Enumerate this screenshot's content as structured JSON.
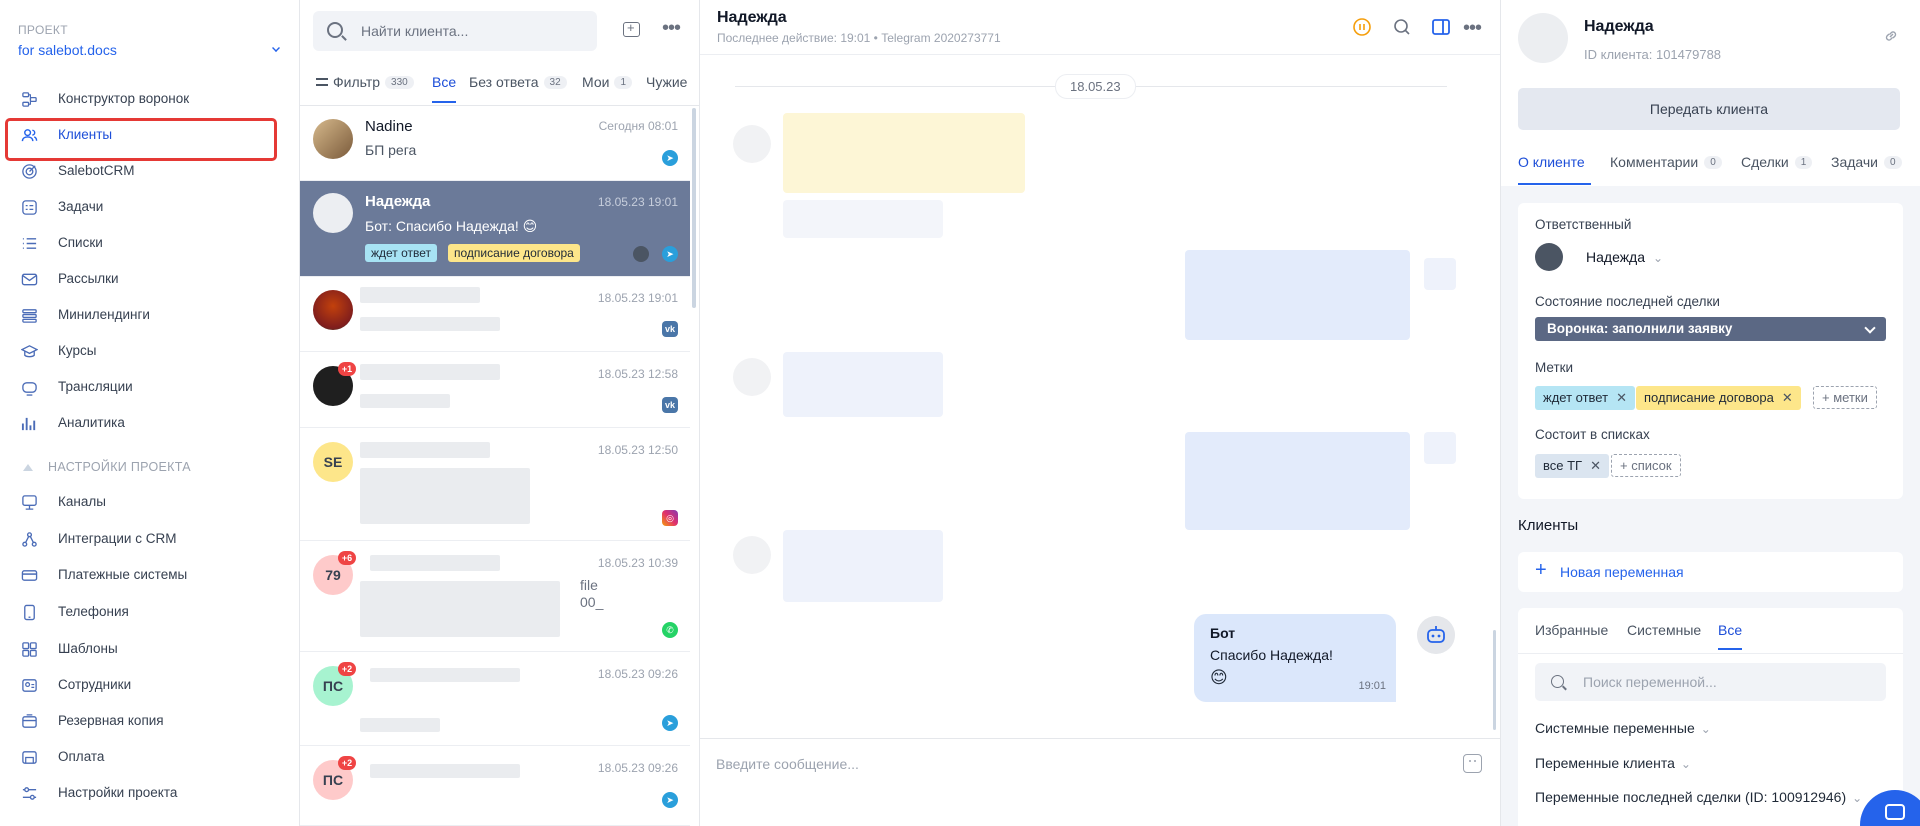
{
  "sidebar": {
    "project_caption": "ПРОЕКТ",
    "project_name": "for salebot.docs",
    "items": [
      {
        "label": "Конструктор воронок",
        "icon": "funnel-builder-icon"
      },
      {
        "label": "Клиенты",
        "icon": "users-icon",
        "active": true
      },
      {
        "label": "SalebotCRM",
        "icon": "crm-icon"
      },
      {
        "label": "Задачи",
        "icon": "tasks-icon"
      },
      {
        "label": "Списки",
        "icon": "lists-icon"
      },
      {
        "label": "Рассылки",
        "icon": "mailing-icon"
      },
      {
        "label": "Минилендинги",
        "icon": "landing-icon"
      },
      {
        "label": "Курсы",
        "icon": "courses-icon"
      },
      {
        "label": "Трансляции",
        "icon": "broadcast-icon"
      },
      {
        "label": "Аналитика",
        "icon": "analytics-icon"
      }
    ],
    "settings_header": "НАСТРОЙКИ ПРОЕКТА",
    "settings_items": [
      {
        "label": "Каналы",
        "icon": "channels-icon"
      },
      {
        "label": "Интеграции с CRM",
        "icon": "integrations-icon"
      },
      {
        "label": "Платежные системы",
        "icon": "payment-icon"
      },
      {
        "label": "Телефония",
        "icon": "phone-icon"
      },
      {
        "label": "Шаблоны",
        "icon": "templates-icon"
      },
      {
        "label": "Сотрудники",
        "icon": "staff-icon"
      },
      {
        "label": "Резервная копия",
        "icon": "backup-icon"
      },
      {
        "label": "Оплата",
        "icon": "billing-icon"
      },
      {
        "label": "Настройки проекта",
        "icon": "settings-icon"
      }
    ]
  },
  "client_list": {
    "search_placeholder": "Найти клиента...",
    "tabs": [
      {
        "label": "Фильтр",
        "count": "330"
      },
      {
        "label": "Все"
      },
      {
        "label": "Без ответа",
        "count": "32"
      },
      {
        "label": "Мои",
        "count": "1"
      },
      {
        "label": "Чужие"
      }
    ],
    "rows": [
      {
        "name": "Nadine",
        "message": "БП рега",
        "time": "Сегодня 08:01",
        "messenger": "telegram"
      },
      {
        "name": "Надежда",
        "message": "Бот: Спасибо Надежда! 😊",
        "time": "18.05.23 19:01",
        "messenger": "telegram",
        "tags": [
          "ждет ответ",
          "подписание договора"
        ]
      },
      {
        "time": "18.05.23 19:01",
        "messenger": "vk"
      },
      {
        "time": "18.05.23 12:58",
        "messenger": "vk",
        "badge": "+1"
      },
      {
        "initials": "SE",
        "time": "18.05.23 12:50",
        "messenger": "instagram"
      },
      {
        "initials": "79",
        "time": "18.05.23 10:39",
        "messenger": "whatsapp",
        "badge": "+6",
        "snippet": "file\n00_"
      },
      {
        "initials": "ПС",
        "time": "18.05.23 09:26",
        "messenger": "telegram",
        "badge": "+2"
      },
      {
        "initials": "ПС",
        "time": "18.05.23 09:26",
        "messenger": "telegram",
        "badge": "+2"
      }
    ]
  },
  "chat": {
    "title": "Надежда",
    "subtitle": "Последнее действие:  19:01 • Telegram 2020273771",
    "date_separator": "18.05.23",
    "bot_message": {
      "sender": "Бот",
      "text": "Спасибо Надежда!",
      "emoji": "😊",
      "time": "19:01"
    },
    "input_placeholder": "Введите сообщение..."
  },
  "client_panel": {
    "name": "Надежда",
    "client_id": "ID клиента: 101479788",
    "transfer_button": "Передать клиента",
    "tabs": [
      {
        "label": "О клиенте"
      },
      {
        "label": "Комментарии",
        "count": "0"
      },
      {
        "label": "Сделки",
        "count": "1"
      },
      {
        "label": "Задачи",
        "count": "0"
      }
    ],
    "responsible_label": "Ответственный",
    "responsible_name": "Надежда",
    "last_deal_label": "Состояние последней сделки",
    "last_deal_value": "Воронка: заполнили заявку",
    "tags_label": "Метки",
    "tags": [
      "ждет ответ",
      "подписание договора"
    ],
    "add_tag": "+ метки",
    "lists_label": "Состоит в списках",
    "lists": [
      "все ТГ"
    ],
    "add_list": "+ список",
    "clients_section": "Клиенты",
    "new_variable": "Новая переменная",
    "var_tabs": [
      "Избранные",
      "Системные",
      "Все"
    ],
    "var_search_placeholder": "Поиск переменной...",
    "var_groups": [
      "Системные переменные",
      "Переменные клиента",
      "Переменные последней сделки (ID: 100912946)"
    ]
  },
  "colors": {
    "accent": "#2563eb",
    "selected_row": "#6b7a99",
    "highlight_border": "#e53935",
    "tag_blue": "#a7e3f4",
    "tag_yellow": "#fde68a"
  }
}
